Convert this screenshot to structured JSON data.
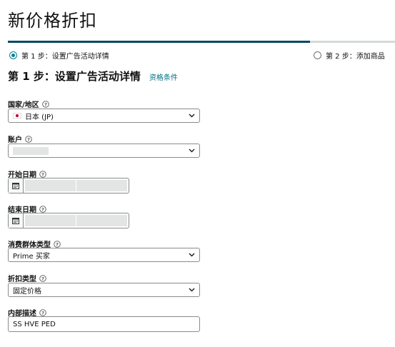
{
  "page": {
    "title": "新价格折扣"
  },
  "progress": {
    "fraction": 0.78
  },
  "steps": [
    {
      "label": "第 1 步：设置广告活动详情",
      "selected": true
    },
    {
      "label": "第 2 步：添加商品",
      "selected": false
    }
  ],
  "section": {
    "title": "第 1 步：设置广告活动详情",
    "link": "资格条件"
  },
  "fields": {
    "country": {
      "label": "国家/地区",
      "value": "日本 (JP)"
    },
    "account": {
      "label": "账户",
      "value": ""
    },
    "start_date": {
      "label": "开始日期"
    },
    "end_date": {
      "label": "结束日期"
    },
    "customer_type": {
      "label": "消费群体类型",
      "value": "Prime 买家"
    },
    "discount_type": {
      "label": "折扣类型",
      "value": "固定价格"
    },
    "internal_desc": {
      "label": "内部描述",
      "value": "SS HVE PED"
    }
  },
  "icons": {
    "help": "help-circle-icon",
    "chevron": "chevron-down-icon",
    "calendar": "calendar-icon",
    "flag": "japan-flag-icon"
  },
  "colors": {
    "accent": "#008296",
    "progress": "#08495b",
    "link": "#007185"
  }
}
